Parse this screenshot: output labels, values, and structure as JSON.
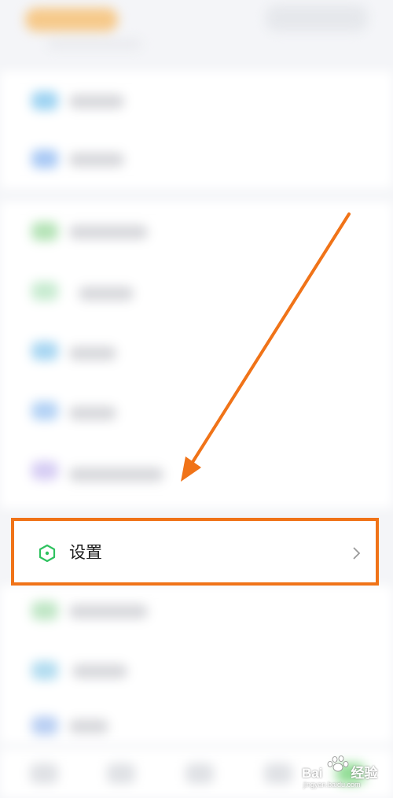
{
  "settings_row": {
    "label": "设置",
    "icon": "hexagon-settings-icon",
    "chevron": "chevron-right-icon",
    "accent": "#2ec25f"
  },
  "annotation": {
    "arrow_color": "#f07318",
    "highlight_color": "#f07318"
  },
  "watermark": {
    "brand": "Bai",
    "suffix": "经验",
    "url": "jingyan.baidu.com"
  }
}
